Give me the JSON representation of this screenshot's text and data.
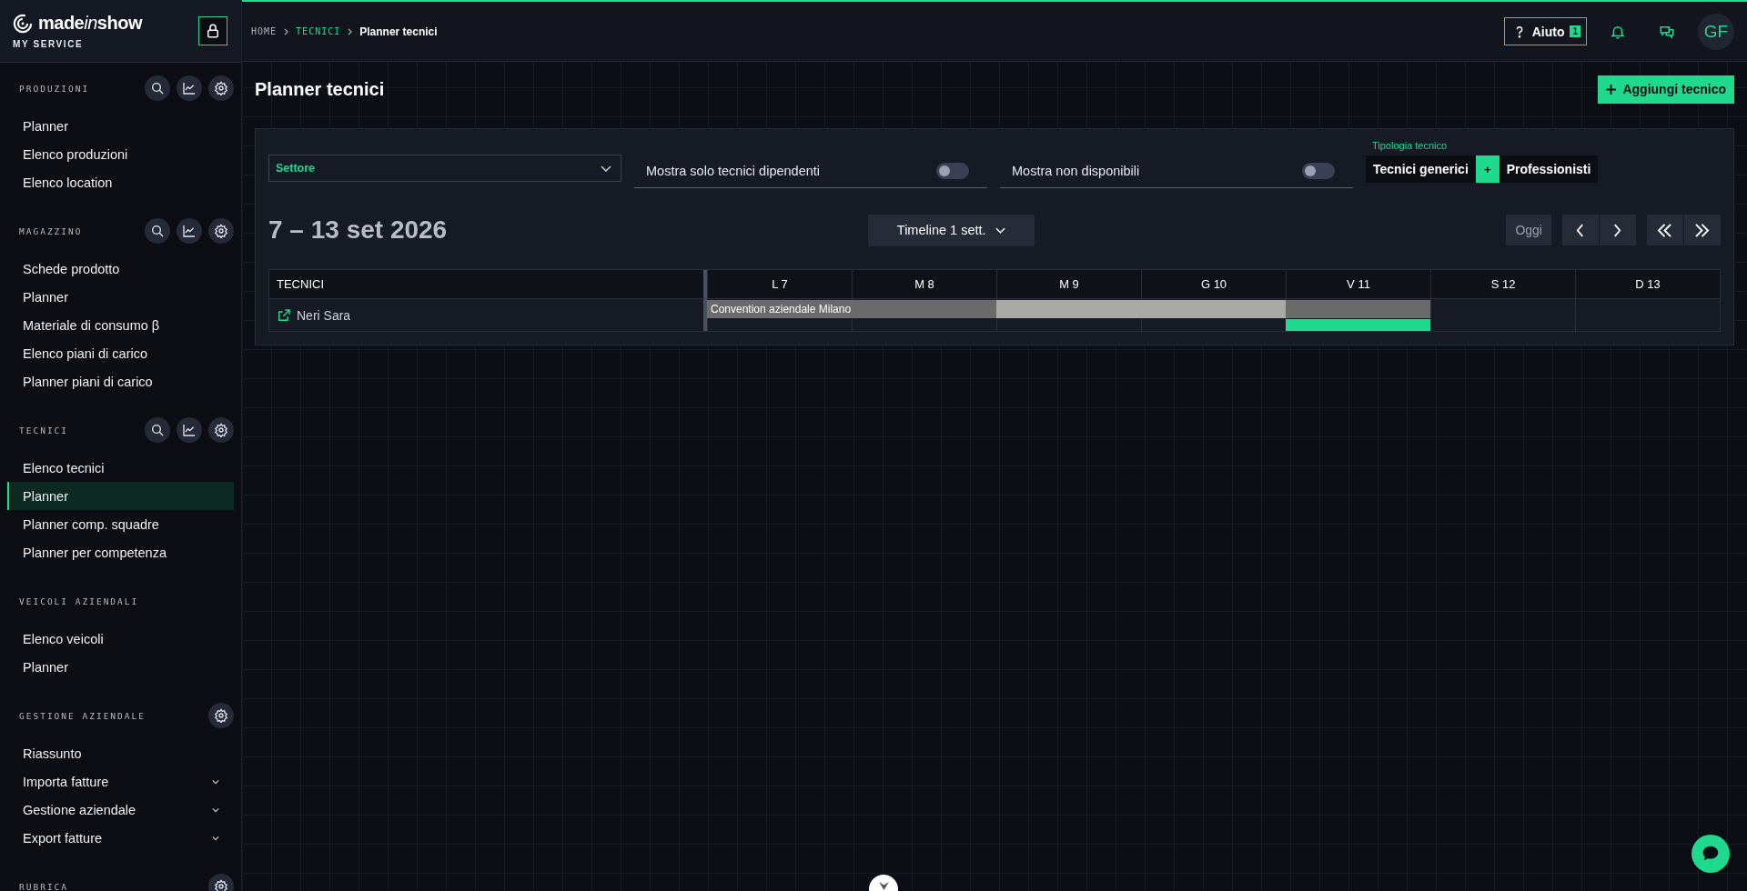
{
  "brand": {
    "name_start": "made",
    "name_italic": "in",
    "name_end": "show",
    "subtitle": "MY SERVICE"
  },
  "sidebar": {
    "sections": [
      {
        "title": "PRODUZIONI",
        "tools": [
          {
            "kind": "search"
          },
          {
            "kind": "chart"
          },
          {
            "kind": "settings"
          }
        ],
        "items": [
          {
            "label": "Planner",
            "selected": false
          },
          {
            "label": "Elenco produzioni",
            "selected": false
          },
          {
            "label": "Elenco location",
            "selected": false
          }
        ]
      },
      {
        "title": "MAGAZZINO",
        "tools": [
          {
            "kind": "search"
          },
          {
            "kind": "chart"
          },
          {
            "kind": "settings"
          }
        ],
        "items": [
          {
            "label": "Schede prodotto",
            "selected": false
          },
          {
            "label": "Planner",
            "selected": false
          },
          {
            "label": "Materiale di consumo β",
            "selected": false
          },
          {
            "label": "Elenco piani di carico",
            "selected": false
          },
          {
            "label": "Planner piani di carico",
            "selected": false
          }
        ]
      },
      {
        "title": "TECNICI",
        "tools": [
          {
            "kind": "search"
          },
          {
            "kind": "chart"
          },
          {
            "kind": "settings"
          }
        ],
        "items": [
          {
            "label": "Elenco tecnici",
            "selected": false
          },
          {
            "label": "Planner",
            "selected": true
          },
          {
            "label": "Planner comp. squadre",
            "selected": false
          },
          {
            "label": "Planner per competenza",
            "selected": false
          }
        ]
      },
      {
        "title": "VEICOLI AZIENDALI",
        "items": [
          {
            "label": "Elenco veicoli",
            "selected": false
          },
          {
            "label": "Planner",
            "selected": false
          }
        ]
      },
      {
        "title": "GESTIONE AZIENDALE",
        "tools": [
          {
            "kind": "settings"
          }
        ],
        "items": [
          {
            "label": "Riassunto",
            "selected": false,
            "expandable": false
          },
          {
            "label": "Importa fatture",
            "selected": false,
            "expandable": true
          },
          {
            "label": "Gestione aziendale",
            "selected": false,
            "expandable": true
          },
          {
            "label": "Export fatture",
            "selected": false,
            "expandable": true
          }
        ]
      },
      {
        "title": "RUBRICA",
        "tools": [
          {
            "kind": "settings"
          }
        ]
      }
    ]
  },
  "breadcrumb": [
    {
      "label": "HOME",
      "kind": "root"
    },
    {
      "label": "TECNICI",
      "kind": "link"
    },
    {
      "label": "Planner tecnici",
      "kind": "current"
    }
  ],
  "header": {
    "help_label": "Aiuto",
    "help_badge": "1",
    "avatar": "GF"
  },
  "page_title": "Planner tecnici",
  "add_button": "Aggiungi tecnico",
  "filters": {
    "sector": {
      "placeholder": "Settore"
    },
    "toggles": [
      {
        "label": "Mostra solo tecnici dipendenti",
        "on": false
      },
      {
        "label": "Mostra non disponibili",
        "on": false
      }
    ],
    "type_label": "Tipologia tecnico",
    "type_options": [
      {
        "label": "Tecnici generici",
        "kind": "option"
      },
      {
        "label": "+",
        "kind": "add"
      },
      {
        "label": "Professionisti",
        "kind": "option"
      }
    ]
  },
  "range": "7 – 13 set 2026",
  "view_select": "Timeline 1 sett.",
  "today_button": "Oggi",
  "table": {
    "first_column": "TECNICI",
    "days": [
      "L 7",
      "M 8",
      "M 9",
      "G 10",
      "V 11",
      "S 12",
      "D 13"
    ],
    "rows": [
      {
        "name": "Neri Sara",
        "event_label": "Convention aziendale Milano",
        "cells": [
          {
            "kind": "dark",
            "available": false
          },
          {
            "kind": "dark",
            "available": false
          },
          {
            "kind": "light",
            "available": false
          },
          {
            "kind": "light",
            "available": false
          },
          {
            "kind": "dark",
            "available": true
          },
          {
            "kind": "empty",
            "available": false
          },
          {
            "kind": "empty",
            "available": false
          }
        ]
      }
    ]
  }
}
